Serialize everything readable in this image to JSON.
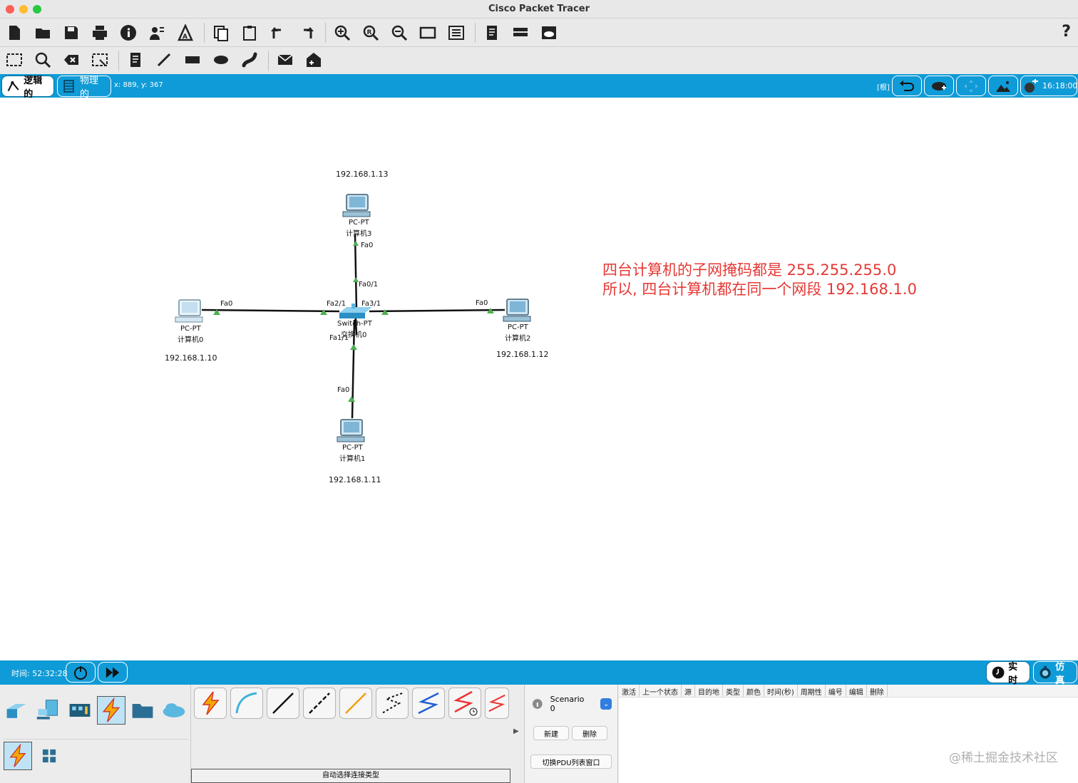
{
  "window": {
    "title": "Cisco Packet Tracer"
  },
  "toolbar": {
    "help_label": "?"
  },
  "workspace_bar": {
    "tab_logical": "逻辑的",
    "tab_physical": "物理的",
    "coords": "x: 889, y: 367",
    "root_label": "[根]",
    "clock": "16:18:00"
  },
  "topology": {
    "switch": {
      "model": "Switch-PT",
      "name": "交换机0"
    },
    "pcs": [
      {
        "model": "PC-PT",
        "name": "计算机0",
        "ip": "192.168.1.10"
      },
      {
        "model": "PC-PT",
        "name": "计算机1",
        "ip": "192.168.1.11"
      },
      {
        "model": "PC-PT",
        "name": "计算机2",
        "ip": "192.168.1.12"
      },
      {
        "model": "PC-PT",
        "name": "计算机3",
        "ip": "192.168.1.13"
      }
    ],
    "ports": {
      "pc3_port": "Fa0",
      "sw_pc3": "Fa0/1",
      "pc0_port": "Fa0",
      "sw_pc0": "Fa2/1",
      "pc2_port": "Fa0",
      "sw_pc2": "Fa3/1",
      "pc1_port": "Fa0",
      "sw_pc1": "Fa1/1"
    },
    "link_color": "#111111",
    "link_light_color": "#4caf50"
  },
  "note": {
    "line1": "四台计算机的子网掩码都是 255.255.255.0",
    "line2": "所以, 四台计算机都在同一个网段 192.168.1.0",
    "color": "#e53935"
  },
  "time_bar": {
    "time_text": "时间: 52:32:28",
    "realtime_label": "实时",
    "simulation_label": "仿真"
  },
  "connections": {
    "status_text": "自动选择连接类型"
  },
  "scenario": {
    "selected": "Scenario 0",
    "new_label": "新建",
    "delete_label": "删除",
    "toggle_label": "切换PDU列表窗口"
  },
  "pdu_list": {
    "headers": [
      "激活",
      "上一个状态",
      "源",
      "目的地",
      "类型",
      "颜色",
      "时间(秒)",
      "周期性",
      "编号",
      "编辑",
      "删除"
    ]
  },
  "watermark": "@稀土掘金技术社区",
  "colors": {
    "accent_blue": "#0f9bd7"
  }
}
